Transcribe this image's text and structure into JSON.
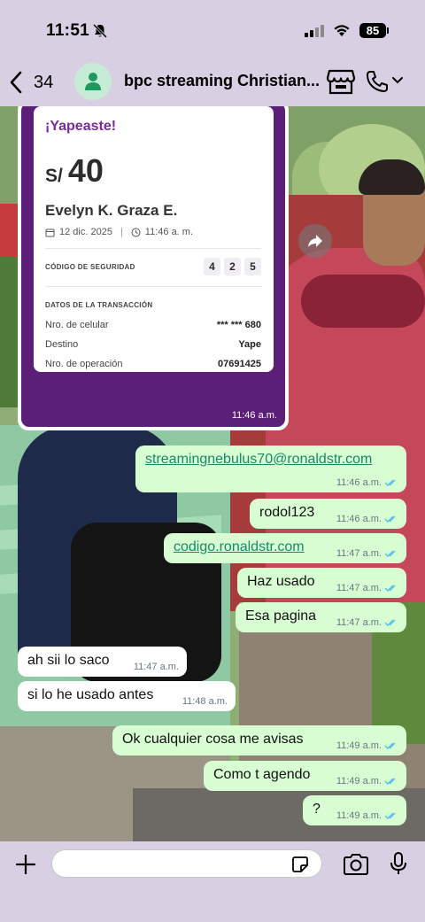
{
  "status_bar": {
    "time": "11:51",
    "battery": "85"
  },
  "header": {
    "back_count": "34",
    "chat_title": "bpc streaming Christian..."
  },
  "receipt": {
    "title": "¡Yapeaste!",
    "currency": "S/",
    "amount": "40",
    "payee": "Evelyn K. Graza E.",
    "date": "12 dic. 2025",
    "time": "11:46 a. m.",
    "security_label": "CÓDIGO DE SEGURIDAD",
    "security_digits": [
      "4",
      "2",
      "5"
    ],
    "transaction_label": "DATOS DE LA TRANSACCIÓN",
    "rows": [
      {
        "label": "Nro. de celular",
        "value": "*** *** 680"
      },
      {
        "label": "Destino",
        "value": "Yape"
      },
      {
        "label": "Nro. de operación",
        "value": "07691425"
      }
    ],
    "message_time": "11:46 a.m."
  },
  "messages": [
    {
      "dir": "out",
      "text": "streamingnebulus70@ronaldstr.com",
      "time": "11:46 a.m.",
      "link": true
    },
    {
      "dir": "out",
      "text": "rodol123",
      "time": "11:46 a.m."
    },
    {
      "dir": "out",
      "text": "codigo.ronaldstr.com",
      "time": "11:47 a.m.",
      "link": true
    },
    {
      "dir": "out",
      "text": "Haz usado",
      "time": "11:47 a.m."
    },
    {
      "dir": "out",
      "text": "Esa pagina",
      "time": "11:47 a.m."
    },
    {
      "dir": "in",
      "text": "ah sii lo saco",
      "time": "11:47 a.m."
    },
    {
      "dir": "in",
      "text": "si lo he usado antes",
      "time": "11:48 a.m."
    },
    {
      "dir": "out",
      "text": "Ok cualquier cosa me avisas",
      "time": "11:49 a.m."
    },
    {
      "dir": "out",
      "text": "Como t agendo",
      "time": "11:49 a.m."
    },
    {
      "dir": "out",
      "text": "?",
      "time": "11:49 a.m."
    }
  ],
  "colors": {
    "chrome_bg": "#d8d0e2",
    "outgoing_bubble": "#d9fdd3",
    "incoming_bubble": "#ffffff",
    "yape_purple": "#5c1f78",
    "read_ticks": "#53bdeb"
  }
}
